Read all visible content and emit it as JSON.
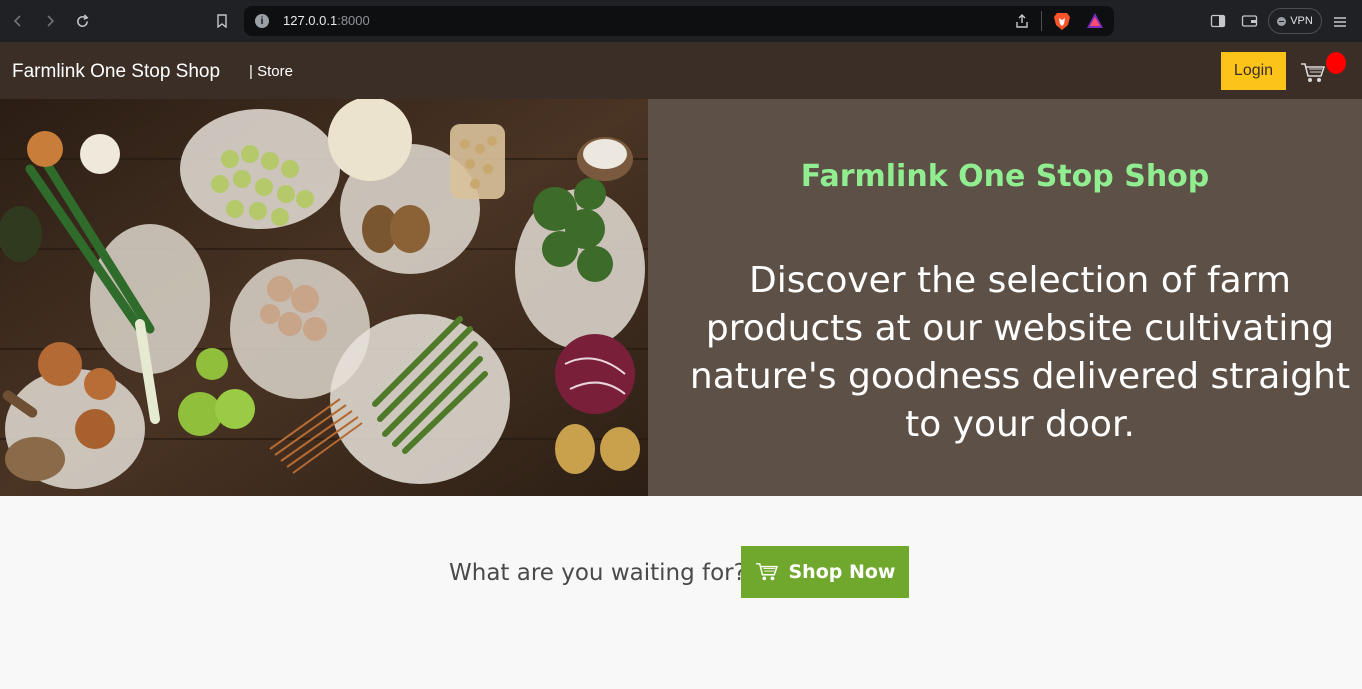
{
  "browser": {
    "url_host": "127.0.0.1",
    "url_port": ":8000",
    "vpn_label": "VPN"
  },
  "nav": {
    "brand": "Farmlink One Stop Shop",
    "store_link": "| Store",
    "login_label": "Login"
  },
  "hero": {
    "title": "Farmlink One Stop Shop",
    "text": "Discover the selection of farm products at our website cultivating nature's goodness delivered straight to your door."
  },
  "cta": {
    "prompt": "What are you waiting for?",
    "button_label": "Shop Now"
  },
  "colors": {
    "navbar": "#3a2e26",
    "hero_panel": "#5c5047",
    "hero_title": "#90ee90",
    "login": "#fcc419",
    "shop_button": "#70a82e",
    "cart_badge": "#ff0000"
  }
}
